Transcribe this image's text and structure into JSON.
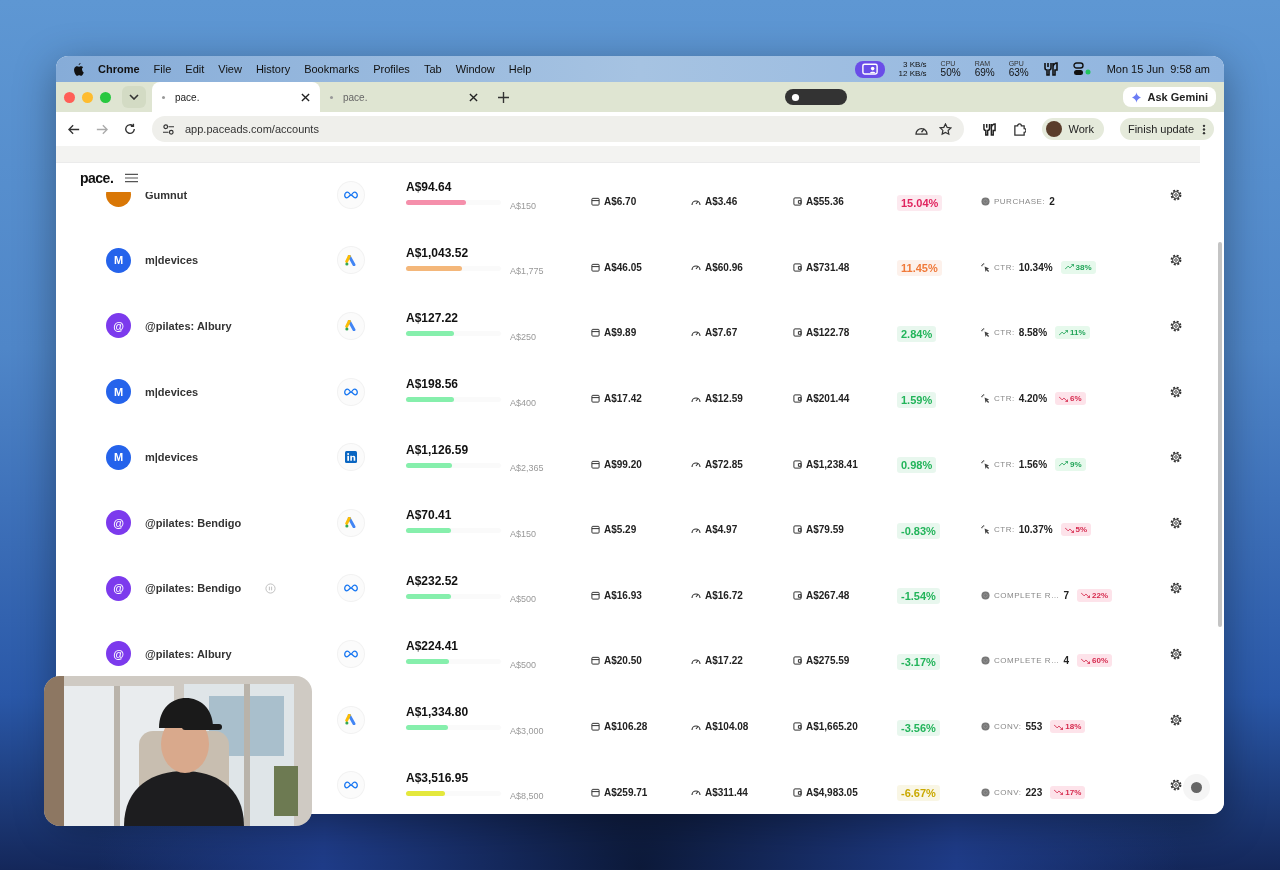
{
  "menu_bar": {
    "app": "Chrome",
    "menus": [
      "File",
      "Edit",
      "View",
      "History",
      "Bookmarks",
      "Profiles",
      "Tab",
      "Window",
      "Help"
    ],
    "net": [
      "3 KB/s",
      "12 KB/s"
    ],
    "stats": [
      {
        "label": "CPU",
        "value": "50%"
      },
      {
        "label": "RAM",
        "value": "69%"
      },
      {
        "label": "GPU",
        "value": "63%"
      }
    ],
    "clock": "Mon 15 Jun  9:58 am"
  },
  "tabs": [
    {
      "title": "pace.",
      "selected": true
    },
    {
      "title": "pace.",
      "selected": false
    }
  ],
  "gemini": "Ask Gemini",
  "address": "app.paceads.com/accounts",
  "profile": "Work",
  "update": "Finish update",
  "logo": "pace.",
  "rows": [
    {
      "account": {
        "color": "#d97706",
        "name": "Gumnut",
        "paused": false
      },
      "platform": {
        "kind": "meta"
      },
      "spend": "A$94.64",
      "bar": {
        "level": 0.63,
        "color": "#f58fab"
      },
      "budget": "A$150",
      "yesterday": "A$6.70",
      "daily": "A$3.46",
      "remaining": "A$55.36",
      "pace": {
        "text": "15.04%",
        "color": "#e0245e"
      },
      "goal": {
        "kind": "purchase",
        "label": "PURCHASE:",
        "value": "2"
      }
    },
    {
      "account": {
        "letter": "M",
        "color": "#2563eb",
        "name": "m|devices",
        "paused": false
      },
      "platform": {
        "kind": "google"
      },
      "spend": "A$1,043.52",
      "bar": {
        "level": 0.59,
        "color": "#f4b77a"
      },
      "budget": "A$1,775",
      "yesterday": "A$46.05",
      "daily": "A$60.96",
      "remaining": "A$731.48",
      "pace": {
        "text": "11.45%",
        "color": "#f07a3a"
      },
      "goal": {
        "kind": "ctr",
        "label": "CTR:",
        "value": "10.34%",
        "trend": {
          "text": "38%",
          "kind": "up"
        }
      }
    },
    {
      "account": {
        "letter": "@",
        "color": "#7c3aed",
        "name": "@pilates: Albury",
        "paused": false
      },
      "platform": {
        "kind": "google"
      },
      "spend": "A$127.22",
      "bar": {
        "level": 0.51,
        "color": "#86efac"
      },
      "budget": "A$250",
      "yesterday": "A$9.89",
      "daily": "A$7.67",
      "remaining": "A$122.78",
      "pace": {
        "text": "2.84%",
        "color": "#22b45a"
      },
      "goal": {
        "kind": "ctr",
        "label": "CTR:",
        "value": "8.58%",
        "trend": {
          "text": "11%",
          "kind": "up"
        }
      }
    },
    {
      "account": {
        "letter": "M",
        "color": "#2563eb",
        "name": "m|devices",
        "paused": false
      },
      "platform": {
        "kind": "meta"
      },
      "spend": "A$198.56",
      "bar": {
        "level": 0.5,
        "color": "#86efac"
      },
      "budget": "A$400",
      "yesterday": "A$17.42",
      "daily": "A$12.59",
      "remaining": "A$201.44",
      "pace": {
        "text": "1.59%",
        "color": "#22b45a"
      },
      "goal": {
        "kind": "ctr",
        "label": "CTR:",
        "value": "4.20%",
        "trend": {
          "text": "6%",
          "kind": "down"
        }
      }
    },
    {
      "account": {
        "letter": "M",
        "color": "#2563eb",
        "name": "m|devices",
        "paused": false
      },
      "platform": {
        "kind": "linkedin"
      },
      "spend": "A$1,126.59",
      "bar": {
        "level": 0.48,
        "color": "#86efac"
      },
      "budget": "A$2,365",
      "yesterday": "A$99.20",
      "daily": "A$72.85",
      "remaining": "A$1,238.41",
      "pace": {
        "text": "0.98%",
        "color": "#22b45a"
      },
      "goal": {
        "kind": "ctr",
        "label": "CTR:",
        "value": "1.56%",
        "trend": {
          "text": "9%",
          "kind": "up"
        }
      }
    },
    {
      "account": {
        "letter": "@",
        "color": "#7c3aed",
        "name": "@pilates: Bendigo",
        "paused": false
      },
      "platform": {
        "kind": "google"
      },
      "spend": "A$70.41",
      "bar": {
        "level": 0.47,
        "color": "#86efac"
      },
      "budget": "A$150",
      "yesterday": "A$5.29",
      "daily": "A$4.97",
      "remaining": "A$79.59",
      "pace": {
        "text": "-0.83%",
        "color": "#22b45a"
      },
      "goal": {
        "kind": "ctr",
        "label": "CTR:",
        "value": "10.37%",
        "trend": {
          "text": "5%",
          "kind": "down"
        }
      }
    },
    {
      "account": {
        "letter": "@",
        "color": "#7c3aed",
        "name": "@pilates: Bendigo",
        "paused": true
      },
      "platform": {
        "kind": "meta"
      },
      "spend": "A$232.52",
      "bar": {
        "level": 0.47,
        "color": "#86efac"
      },
      "budget": "A$500",
      "yesterday": "A$16.93",
      "daily": "A$16.72",
      "remaining": "A$267.48",
      "pace": {
        "text": "-1.54%",
        "color": "#22b45a"
      },
      "goal": {
        "kind": "complete",
        "label": "COMPLETE R…",
        "value": "7",
        "trend": {
          "text": "22%",
          "kind": "down"
        }
      }
    },
    {
      "account": {
        "letter": "@",
        "color": "#7c3aed",
        "name": "@pilates: Albury",
        "paused": false
      },
      "platform": {
        "kind": "meta"
      },
      "spend": "A$224.41",
      "bar": {
        "level": 0.45,
        "color": "#86efac"
      },
      "budget": "A$500",
      "yesterday": "A$20.50",
      "daily": "A$17.22",
      "remaining": "A$275.59",
      "pace": {
        "text": "-3.17%",
        "color": "#22b45a"
      },
      "goal": {
        "kind": "complete",
        "label": "COMPLETE R…",
        "value": "4",
        "trend": {
          "text": "60%",
          "kind": "down"
        }
      }
    },
    {
      "platform": {
        "kind": "google"
      },
      "spend": "A$1,334.80",
      "bar": {
        "level": 0.44,
        "color": "#86efac"
      },
      "budget": "A$3,000",
      "yesterday": "A$106.28",
      "daily": "A$104.08",
      "remaining": "A$1,665.20",
      "pace": {
        "text": "-3.56%",
        "color": "#22b45a"
      },
      "goal": {
        "kind": "conv",
        "label": "CONV:",
        "value": "553",
        "trend": {
          "text": "18%",
          "kind": "down"
        }
      }
    },
    {
      "platform": {
        "kind": "meta"
      },
      "spend": "A$3,516.95",
      "bar": {
        "level": 0.41,
        "color": "#e4e83c"
      },
      "budget": "A$8,500",
      "yesterday": "A$259.71",
      "daily": "A$311.44",
      "remaining": "A$4,983.05",
      "pace": {
        "text": "-6.67%",
        "color": "#c9a800"
      },
      "goal": {
        "kind": "conv",
        "label": "CONV:",
        "value": "223",
        "trend": {
          "text": "17%",
          "kind": "down"
        }
      }
    }
  ]
}
